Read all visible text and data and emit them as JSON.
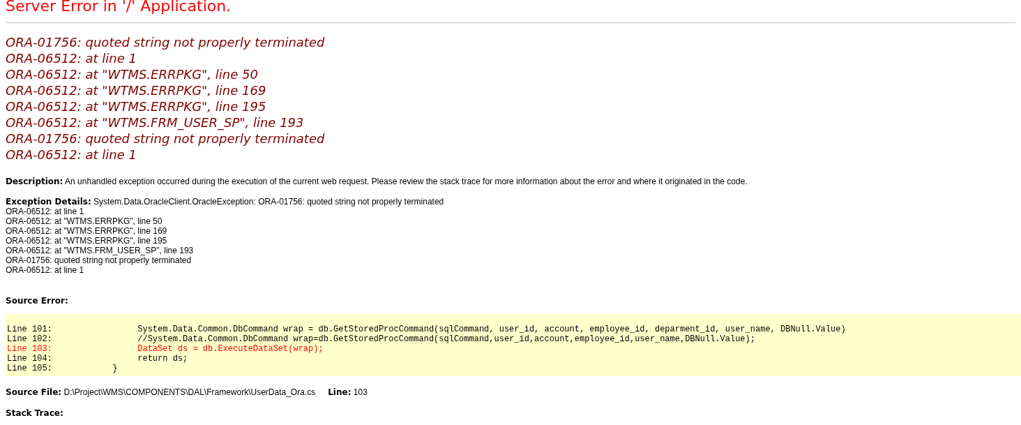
{
  "title": "Server Error in '/' Application.",
  "error_messages": [
    "ORA-01756: quoted string not properly terminated",
    "ORA-06512: at line 1",
    "ORA-06512: at \"WTMS.ERRPKG\", line 50",
    "ORA-06512: at \"WTMS.ERRPKG\", line 169",
    "ORA-06512: at \"WTMS.ERRPKG\", line 195",
    "ORA-06512: at \"WTMS.FRM_USER_SP\", line 193",
    "ORA-01756: quoted string not properly terminated",
    "ORA-06512: at line 1"
  ],
  "description": {
    "label": "Description:",
    "text": "An unhandled exception occurred during the execution of the current web request. Please review the stack trace for more information about the error and where it originated in the code."
  },
  "exception_details": {
    "label": "Exception Details:",
    "lines": [
      "System.Data.OracleClient.OracleException: ORA-01756: quoted string not properly terminated",
      "ORA-06512: at line 1",
      "ORA-06512: at \"WTMS.ERRPKG\", line 50",
      "ORA-06512: at \"WTMS.ERRPKG\", line 169",
      "ORA-06512: at \"WTMS.ERRPKG\", line 195",
      "ORA-06512: at \"WTMS.FRM_USER_SP\", line 193",
      "ORA-01756: quoted string not properly terminated",
      "ORA-06512: at line 1"
    ]
  },
  "source_error": {
    "label": "Source Error:",
    "lines": [
      {
        "text": "Line 101:                 System.Data.Common.DbCommand wrap = db.GetStoredProcCommand(sqlCommand, user_id, account, employee_id, deparment_id, user_name, DBNull.Value)",
        "highlighted": false
      },
      {
        "text": "Line 102:                 //System.Data.Common.DbCommand wrap=db.GetStoredProcCommand(sqlCommand,user_id,account,employee_id,user_name,DBNull.Value);",
        "highlighted": false
      },
      {
        "text": "Line 103:                 DataSet ds = db.ExecuteDataSet(wrap);",
        "highlighted": true
      },
      {
        "text": "Line 104:                 return ds;",
        "highlighted": false
      },
      {
        "text": "Line 105:            }",
        "highlighted": false
      }
    ]
  },
  "source_file": {
    "label": "Source File:",
    "path": "D:\\Project\\WMS\\COMPONENTS\\DAL\\Framework\\UserData_Ora.cs",
    "line_label": "Line:",
    "line": "103"
  },
  "stack_trace": {
    "label": "Stack Trace:"
  }
}
